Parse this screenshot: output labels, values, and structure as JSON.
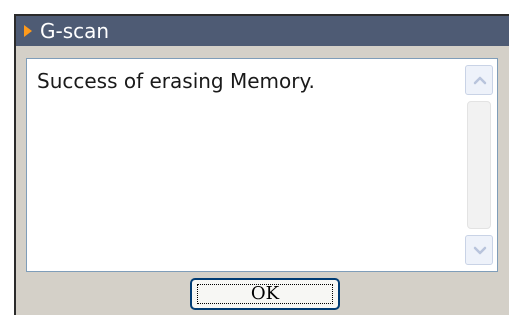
{
  "window": {
    "title": "G-scan",
    "title_icon": "orange-triangle-arrow",
    "title_bar_color": "#4e5b74",
    "title_arrow_color": "#ff9a1a"
  },
  "message": {
    "text": "Success of erasing Memory."
  },
  "scrollbar": {
    "up_icon": "chevron-up-icon",
    "down_icon": "chevron-down-icon"
  },
  "buttons": {
    "ok_label": "OK"
  }
}
